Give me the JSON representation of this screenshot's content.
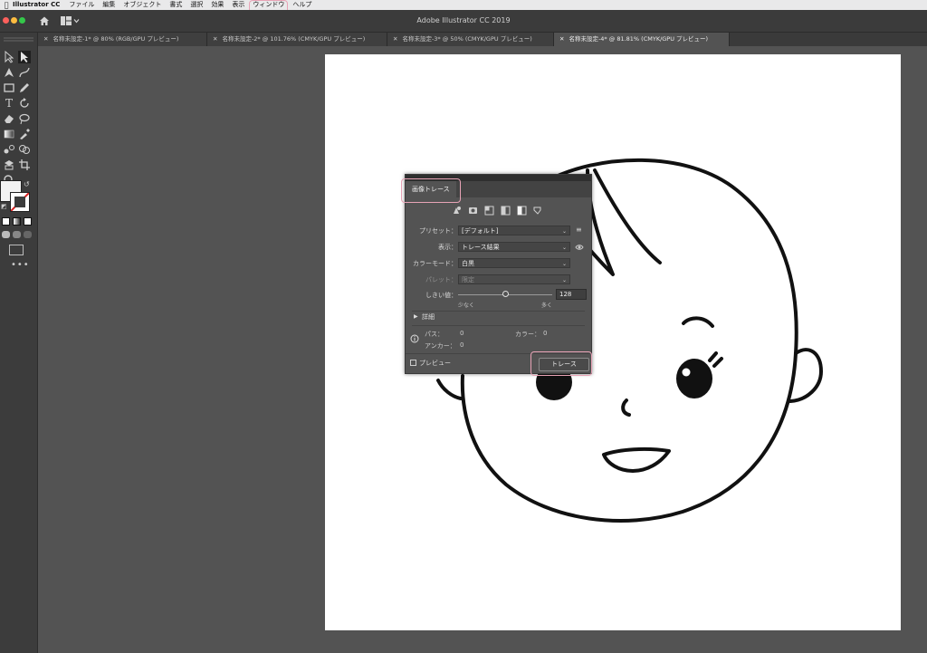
{
  "menubar": {
    "app": "Illustrator CC",
    "items": [
      "ファイル",
      "編集",
      "オブジェクト",
      "書式",
      "選択",
      "効果",
      "表示",
      "ウィンドウ",
      "ヘルプ"
    ]
  },
  "window": {
    "title": "Adobe Illustrator CC 2019"
  },
  "tabs": [
    {
      "label": "名称未設定-1* @ 80% (RGB/GPU プレビュー)"
    },
    {
      "label": "名称未設定-2* @ 101.76% (CMYK/GPU プレビュー)"
    },
    {
      "label": "名称未設定-3* @ 50% (CMYK/GPU プレビュー)"
    },
    {
      "label": "名称未設定-4* @ 81.81% (CMYK/GPU プレビュー)"
    }
  ],
  "panel": {
    "tab": "画像トレース",
    "preset_label": "プリセット：",
    "preset_value": "[デフォルト]",
    "view_label": "表示：",
    "view_value": "トレース結果",
    "mode_label": "カラーモード：",
    "mode_value": "白黒",
    "palette_label": "パレット：",
    "palette_value": "限定",
    "threshold_label": "しきい値：",
    "threshold_value": "128",
    "threshold_fraction": 0.5,
    "threshold_min": "少なく",
    "threshold_max": "多く",
    "advanced": "詳細",
    "paths_label": "パス：",
    "paths_value": "0",
    "colors_label": "カラー：",
    "colors_value": "0",
    "anchors_label": "アンカー：",
    "anchors_value": "0",
    "preview_label": "プレビュー",
    "trace_button": "トレース"
  }
}
